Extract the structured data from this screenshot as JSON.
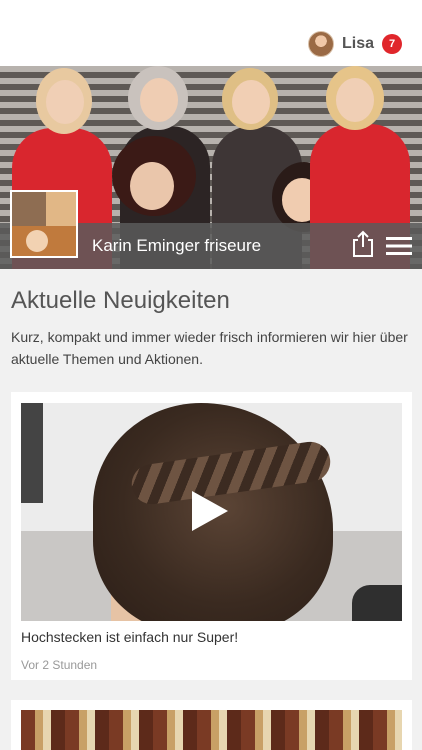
{
  "user": {
    "name": "Lisa",
    "notifications": "7"
  },
  "header": {
    "brand_name": "Karin Eminger friseure"
  },
  "section": {
    "title": "Aktuelle Neuigkeiten",
    "description": "Kurz, kompakt und immer wieder frisch informieren wir hier über aktuelle Themen und Aktionen."
  },
  "posts": [
    {
      "title": "Hochstecken ist einfach nur Super!",
      "time": "Vor 2 Stunden"
    }
  ],
  "colors": {
    "badge": "#e0262b",
    "infobar": "#5a5a5a",
    "background": "#f1f1f1"
  },
  "icons": [
    "share-icon",
    "hamburger-menu-icon",
    "play-icon"
  ]
}
